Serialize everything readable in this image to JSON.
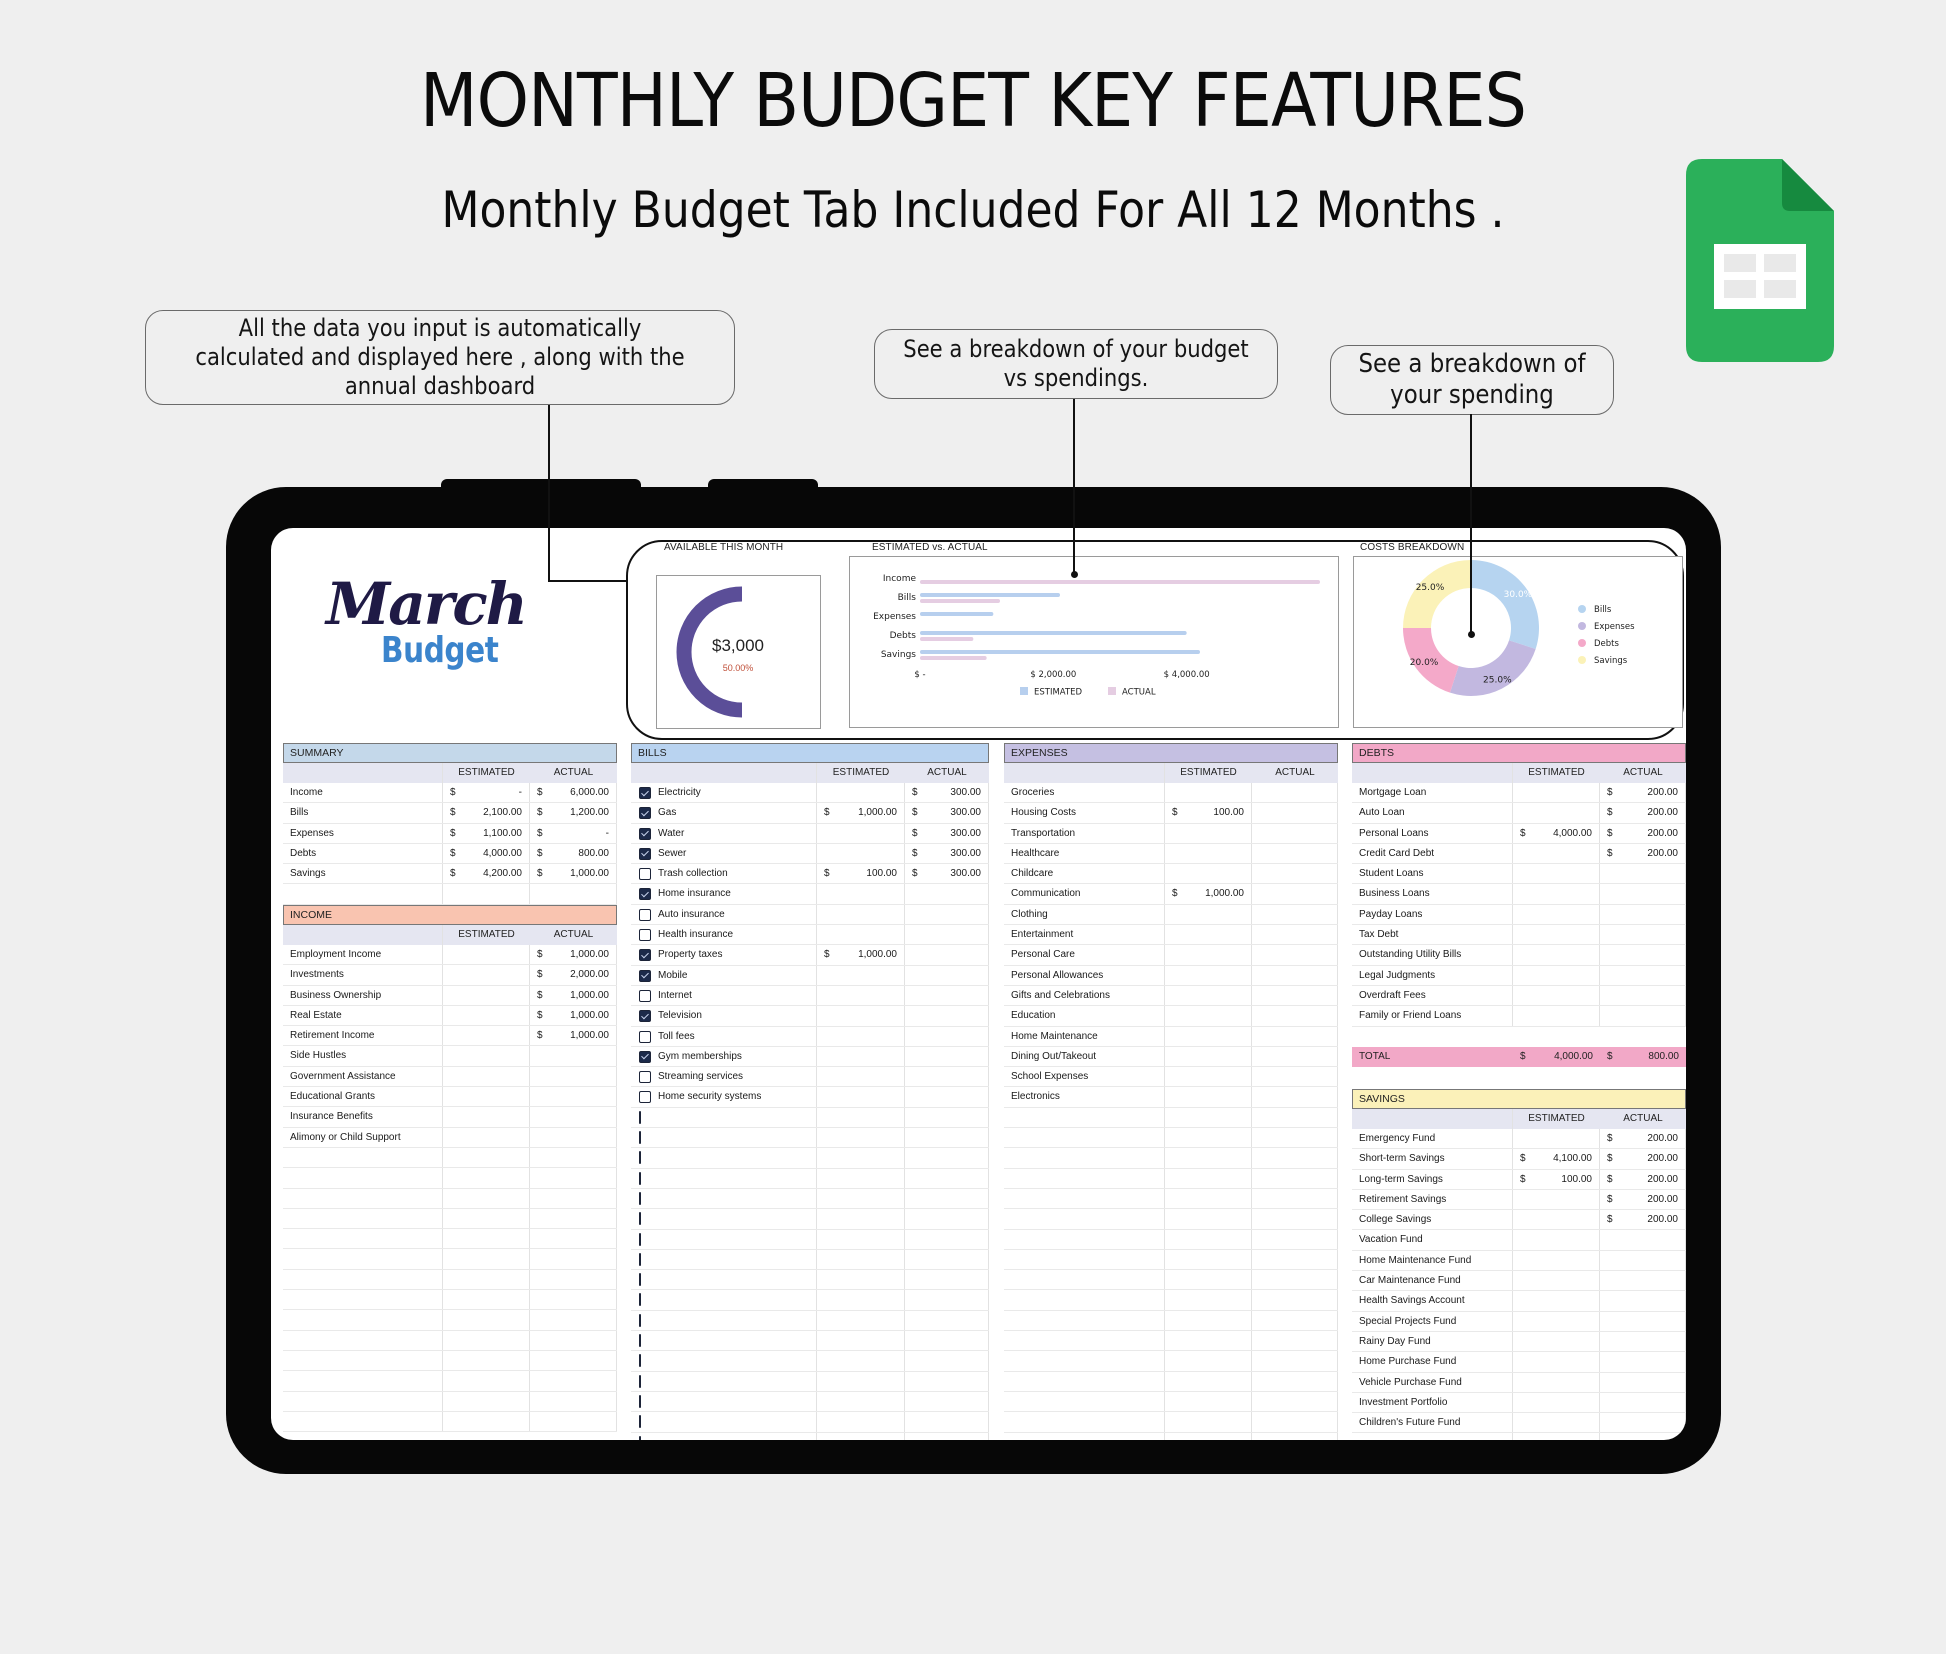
{
  "header": {
    "title": "MONTHLY BUDGET KEY FEATURES",
    "subtitle": "Monthly Budget Tab Included For All 12 Months ."
  },
  "callouts": [
    {
      "text": "All the data you input is automatically calculated and displayed here , along with the annual dashboard"
    },
    {
      "text": "See a breakdown of your budget vs spendings."
    },
    {
      "text": "See a breakdown of your spending"
    }
  ],
  "app_icon": "google-sheets-icon",
  "sheet": {
    "month": "March",
    "subtitle": "Budget",
    "available": {
      "label": "AVAILABLE THIS MONTH",
      "amount": "$3,000",
      "percent_text": "50.00%",
      "fraction": 0.5,
      "color": "#5b4e98"
    },
    "est_vs_actual_label": "ESTIMATED vs. ACTUAL",
    "costs_label": "COSTS BREAKDOWN"
  },
  "chart_data": [
    {
      "type": "bar",
      "orientation": "horizontal",
      "title": "ESTIMATED vs. ACTUAL",
      "categories": [
        "Income",
        "Bills",
        "Expenses",
        "Debts",
        "Savings"
      ],
      "series": [
        {
          "name": "ESTIMATED",
          "color": "#b7cfee",
          "values": [
            0,
            2100,
            1100,
            4000,
            4200
          ]
        },
        {
          "name": "ACTUAL",
          "color": "#e5cde2",
          "values": [
            6000,
            1200,
            0,
            800,
            1000
          ]
        }
      ],
      "xticks": [
        "$ -",
        "$ 2,000.00",
        "$ 4,000.00"
      ],
      "xlim": [
        0,
        6000
      ],
      "legend": "bottom"
    },
    {
      "type": "pie",
      "donut": true,
      "title": "COSTS BREAKDOWN",
      "categories": [
        "Bills",
        "Expenses",
        "Debts",
        "Savings"
      ],
      "values": [
        30.0,
        25.0,
        20.0,
        25.0
      ],
      "labels": [
        "30.0%",
        "25.0%",
        "20.0%",
        "25.0%"
      ],
      "colors": [
        "#b6d4f0",
        "#c2b8e0",
        "#f4a9c9",
        "#fbf2b8"
      ],
      "legend": "right"
    }
  ],
  "tables": {
    "col_est": "ESTIMATED",
    "col_act": "ACTUAL",
    "currency": "$",
    "summary": {
      "title": "SUMMARY",
      "color": "#c4d8ea",
      "rows": [
        {
          "label": "Income",
          "est": "-",
          "act": "6,000.00"
        },
        {
          "label": "Bills",
          "est": "2,100.00",
          "act": "1,200.00"
        },
        {
          "label": "Expenses",
          "est": "1,100.00",
          "act": "-"
        },
        {
          "label": "Debts",
          "est": "4,000.00",
          "act": "800.00"
        },
        {
          "label": "Savings",
          "est": "4,200.00",
          "act": "1,000.00"
        }
      ]
    },
    "income": {
      "title": "INCOME",
      "color": "#f9c4b0",
      "rows": [
        {
          "label": "Employment Income",
          "est": "",
          "act": "1,000.00"
        },
        {
          "label": "Investments",
          "est": "",
          "act": "2,000.00"
        },
        {
          "label": "Business Ownership",
          "est": "",
          "act": "1,000.00"
        },
        {
          "label": "Real Estate",
          "est": "",
          "act": "1,000.00"
        },
        {
          "label": "Retirement Income",
          "est": "",
          "act": "1,000.00"
        },
        {
          "label": "Side Hustles",
          "est": "",
          "act": ""
        },
        {
          "label": "Government Assistance",
          "est": "",
          "act": ""
        },
        {
          "label": "Educational Grants",
          "est": "",
          "act": ""
        },
        {
          "label": "Insurance Benefits",
          "est": "",
          "act": ""
        },
        {
          "label": "Alimony or Child Support",
          "est": "",
          "act": ""
        }
      ]
    },
    "bills": {
      "title": "BILLS",
      "color": "#b9d3f0",
      "rows": [
        {
          "label": "Electricity",
          "checked": true,
          "est": "",
          "act": "300.00"
        },
        {
          "label": "Gas",
          "checked": true,
          "est": "1,000.00",
          "act": "300.00"
        },
        {
          "label": "Water",
          "checked": true,
          "est": "",
          "act": "300.00"
        },
        {
          "label": "Sewer",
          "checked": true,
          "est": "",
          "act": "300.00"
        },
        {
          "label": "Trash collection",
          "checked": false,
          "est": "100.00",
          "act": "300.00"
        },
        {
          "label": "Home insurance",
          "checked": true,
          "est": "",
          "act": ""
        },
        {
          "label": "Auto insurance",
          "checked": false,
          "est": "",
          "act": ""
        },
        {
          "label": "Health insurance",
          "checked": false,
          "est": "",
          "act": ""
        },
        {
          "label": "Property taxes",
          "checked": true,
          "est": "1,000.00",
          "act": ""
        },
        {
          "label": "Mobile",
          "checked": true,
          "est": "",
          "act": ""
        },
        {
          "label": "Internet",
          "checked": false,
          "est": "",
          "act": ""
        },
        {
          "label": "Television",
          "checked": true,
          "est": "",
          "act": ""
        },
        {
          "label": "Toll fees",
          "checked": false,
          "est": "",
          "act": ""
        },
        {
          "label": "Gym memberships",
          "checked": true,
          "est": "",
          "act": ""
        },
        {
          "label": "Streaming services",
          "checked": false,
          "est": "",
          "act": ""
        },
        {
          "label": "Home security systems",
          "checked": false,
          "est": "",
          "act": ""
        }
      ],
      "empty_checkbox_rows": 17
    },
    "expenses": {
      "title": "EXPENSES",
      "color": "#c5c0e2",
      "rows": [
        {
          "label": "Groceries",
          "est": "",
          "act": ""
        },
        {
          "label": "Housing Costs",
          "est": "100.00",
          "act": ""
        },
        {
          "label": "Transportation",
          "est": "",
          "act": ""
        },
        {
          "label": "Healthcare",
          "est": "",
          "act": ""
        },
        {
          "label": "Childcare",
          "est": "",
          "act": ""
        },
        {
          "label": "Communication",
          "est": "1,000.00",
          "act": ""
        },
        {
          "label": "Clothing",
          "est": "",
          "act": ""
        },
        {
          "label": "Entertainment",
          "est": "",
          "act": ""
        },
        {
          "label": "Personal Care",
          "est": "",
          "act": ""
        },
        {
          "label": "Personal Allowances",
          "est": "",
          "act": ""
        },
        {
          "label": "Gifts and Celebrations",
          "est": "",
          "act": ""
        },
        {
          "label": "Education",
          "est": "",
          "act": ""
        },
        {
          "label": "Home Maintenance",
          "est": "",
          "act": ""
        },
        {
          "label": "Dining Out/Takeout",
          "est": "",
          "act": ""
        },
        {
          "label": "School Expenses",
          "est": "",
          "act": ""
        },
        {
          "label": "Electronics",
          "est": "",
          "act": ""
        }
      ]
    },
    "debts": {
      "title": "DEBTS",
      "color": "#f2a8c7",
      "rows": [
        {
          "label": "Mortgage Loan",
          "est": "",
          "act": "200.00"
        },
        {
          "label": "Auto Loan",
          "est": "",
          "act": "200.00"
        },
        {
          "label": "Personal Loans",
          "est": "4,000.00",
          "act": "200.00"
        },
        {
          "label": "Credit Card Debt",
          "est": "",
          "act": "200.00"
        },
        {
          "label": "Student Loans",
          "est": "",
          "act": ""
        },
        {
          "label": "Business Loans",
          "est": "",
          "act": ""
        },
        {
          "label": "Payday Loans",
          "est": "",
          "act": ""
        },
        {
          "label": "Tax Debt",
          "est": "",
          "act": ""
        },
        {
          "label": "Outstanding Utility Bills",
          "est": "",
          "act": ""
        },
        {
          "label": "Legal Judgments",
          "est": "",
          "act": ""
        },
        {
          "label": "Overdraft Fees",
          "est": "",
          "act": ""
        },
        {
          "label": "Family or Friend Loans",
          "est": "",
          "act": ""
        }
      ],
      "total": {
        "label": "TOTAL",
        "est": "4,000.00",
        "act": "800.00"
      }
    },
    "savings": {
      "title": "SAVINGS",
      "color": "#fbf1b9",
      "rows": [
        {
          "label": "Emergency Fund",
          "est": "",
          "act": "200.00"
        },
        {
          "label": "Short-term Savings",
          "est": "4,100.00",
          "act": "200.00"
        },
        {
          "label": "Long-term Savings",
          "est": "100.00",
          "act": "200.00"
        },
        {
          "label": "Retirement Savings",
          "est": "",
          "act": "200.00"
        },
        {
          "label": "College Savings",
          "est": "",
          "act": "200.00"
        },
        {
          "label": "Vacation Fund",
          "est": "",
          "act": ""
        },
        {
          "label": "Home Maintenance Fund",
          "est": "",
          "act": ""
        },
        {
          "label": "Car Maintenance Fund",
          "est": "",
          "act": ""
        },
        {
          "label": "Health Savings Account",
          "est": "",
          "act": ""
        },
        {
          "label": "Special Projects Fund",
          "est": "",
          "act": ""
        },
        {
          "label": "Rainy Day Fund",
          "est": "",
          "act": ""
        },
        {
          "label": "Home Purchase Fund",
          "est": "",
          "act": ""
        },
        {
          "label": "Vehicle Purchase Fund",
          "est": "",
          "act": ""
        },
        {
          "label": "Investment Portfolio",
          "est": "",
          "act": ""
        },
        {
          "label": "Children's Future Fund",
          "est": "",
          "act": ""
        }
      ]
    }
  }
}
